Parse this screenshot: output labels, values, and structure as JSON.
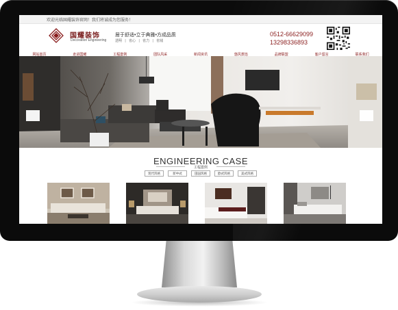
{
  "site": {
    "topbar_text": "欢迎光临国耀装饰官网！我们将诚成为您服务！",
    "logo": {
      "cn": "国耀装饰",
      "en": "Decoration Engineering"
    },
    "slogan": {
      "line1": "居于舒适•立于典雅•方成品质",
      "line2": "透明 | 省心 | 省力 | 省钱"
    },
    "phones": [
      "0512-66629099",
      "13298336893"
    ],
    "nav": [
      "网站首页",
      "走进国耀",
      "工程案例",
      "团队风采",
      "新闻资讯",
      "悠风蒸馅",
      "品牌联盟",
      "客户留言",
      "联系我们"
    ],
    "case_section": {
      "title": "ENGINEERING CASE",
      "subtitle": "工程案例",
      "tabs": [
        "现代风格",
        "新中式",
        "田园风格",
        "欧式风格",
        "美式风格"
      ]
    },
    "accent_color": "#8a1e1e"
  },
  "icons": [
    "logo-mark-icon",
    "qr-code-icon",
    "banner-prev-icon",
    "banner-next-icon"
  ]
}
